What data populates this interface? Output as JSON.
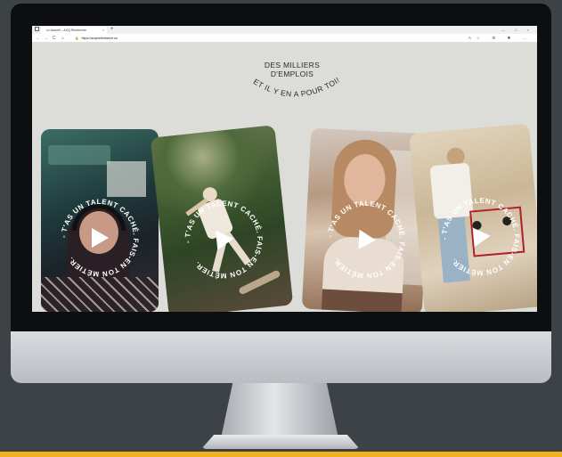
{
  "browser": {
    "tab_title": "••• Accueil – ACQ Recherche",
    "tab_close": "×",
    "new_tab": "+",
    "window_controls": "— □ ×",
    "nav_back": "←",
    "nav_forward": "→",
    "nav_reload": "C",
    "nav_home": "⌂",
    "url": "https://acqmetiertalent.ca",
    "url_lock": "🔒",
    "toolbar_icons": "A☆ ⚙ ✱ …"
  },
  "page": {
    "headline_line1": "DES MILLIERS",
    "headline_line2": "D'EMPLOIS",
    "headline_arc": "ET IL Y EN A POUR TOI!",
    "cards": [
      {
        "ring_text": "- T'AS UN TALENT CACHÉ. FAIS-EN TON MÉTIER. "
      },
      {
        "ring_text": "- T'AS UN TALENT CACHÉ. FAIS-EN TON MÉTIER. "
      },
      {
        "ring_text": "- T'AS UN TALENT CACHÉ. FAIS-EN TON MÉTIER. "
      },
      {
        "ring_text": "- T'AS UN TALENT CACHÉ. FAIS-EN TON MÉTIER. "
      }
    ]
  },
  "colors": {
    "background": "#3c4245",
    "accent_bar": "#f2b21b",
    "screen_bg": "#dcdcd9"
  }
}
